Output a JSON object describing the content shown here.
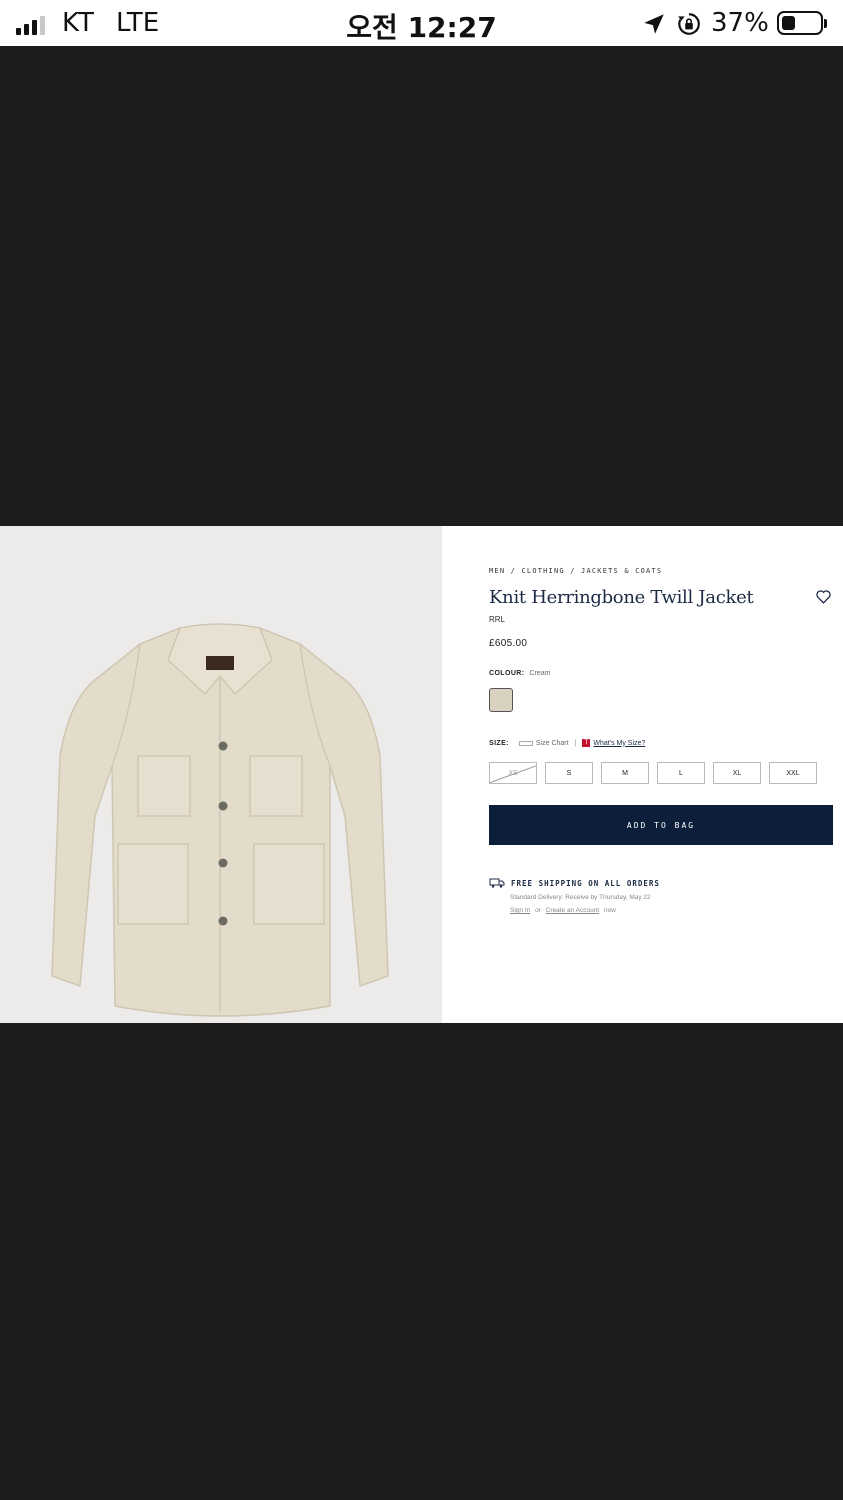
{
  "status_bar": {
    "carrier": "KT",
    "network": "LTE",
    "time": "오전 12:27",
    "battery_percent": "37%",
    "battery_level": 0.37,
    "signal_bars": 3,
    "icons": [
      "location-arrow-icon",
      "rotation-lock-icon",
      "battery-icon"
    ]
  },
  "product": {
    "breadcrumb": "MEN / CLOTHING / JACKETS & COATS",
    "title": "Knit Herringbone Twill Jacket",
    "brand": "RRL",
    "price": "£605.00",
    "colour_label": "COLOUR:",
    "colour_value": "Cream",
    "swatch_color": "#d9d2c0",
    "size_label": "SIZE:",
    "size_chart": "Size Chart",
    "whats_my_size": "What's My Size?",
    "sizes": [
      {
        "label": "XS",
        "available": false
      },
      {
        "label": "S",
        "available": true
      },
      {
        "label": "M",
        "available": true
      },
      {
        "label": "L",
        "available": true
      },
      {
        "label": "XL",
        "available": true
      },
      {
        "label": "XXL",
        "available": true
      }
    ],
    "add_to_bag": "ADD TO BAG",
    "shipping": "FREE SHIPPING ON ALL ORDERS",
    "delivery": "Standard Delivery: Receive by Thursday, May 22",
    "sign_in": "Sign In",
    "or": "or",
    "create_account": "Create an Account",
    "now": "now"
  },
  "colors": {
    "background": "#1e1d1c",
    "navy": "#0d1e3a",
    "image_bg": "#ecebe9",
    "jacket": "#e3dccb"
  }
}
